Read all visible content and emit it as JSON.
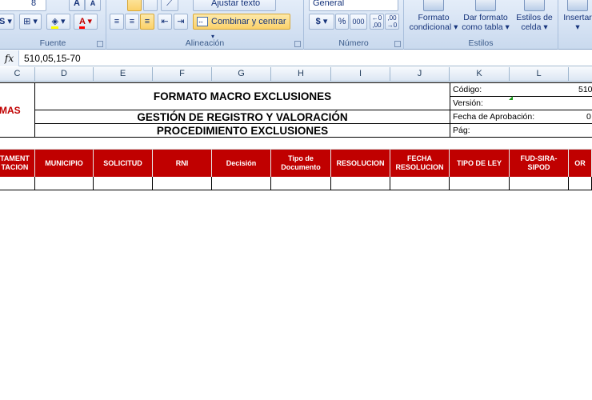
{
  "ribbon": {
    "font_group": {
      "label": "Fuente",
      "font_size": "8",
      "grow_label": "A",
      "shrink_label": "A"
    },
    "alignment_group": {
      "label": "Alineación",
      "wrap_label": "Ajustar texto",
      "merge_label": "Combinar y centrar"
    },
    "number_group": {
      "label": "Número",
      "format_value": "General",
      "currency": "$",
      "percent": "%",
      "thousands": "000",
      "inc_decimals": "+,0\n,00",
      "dec_decimals": ",00\n→,0"
    },
    "styles_group": {
      "label": "Estilos",
      "conditional": "Formato condicional",
      "as_table": "Dar formato como tabla",
      "cell_styles": "Estilos de celda"
    },
    "cells_group": {
      "insert": "Insertar"
    }
  },
  "formula_bar": {
    "fx": "fx",
    "value": "510,05,15-70"
  },
  "columns": [
    "C",
    "D",
    "E",
    "F",
    "G",
    "H",
    "I",
    "J",
    "K",
    "L"
  ],
  "header": {
    "logo_text": "MAS",
    "title1": "FORMATO MACRO EXCLUSIONES",
    "title2": "GESTIÓN DE REGISTRO Y VALORACIÓN",
    "title3": "PROCEDIMIENTO EXCLUSIONES",
    "codigo_label": "Código:",
    "codigo_value": "510",
    "version_label": "Versión:",
    "fecha_label": "Fecha de Aprobación:",
    "fecha_value": "0",
    "pag_label": "Pág:"
  },
  "table_headers": [
    "TAMENT\nTACION",
    "MUNICIPIO",
    "SOLICITUD",
    "RNI",
    "Decisión",
    "Tipo de\nDocumento",
    "RESOLUCION",
    "FECHA\nRESOLUCION",
    "TIPO DE LEY",
    "FUD-SIRA-SIPOD",
    "OR"
  ],
  "colors": {
    "header_red": "#c00000",
    "logo_red": "#c00000"
  }
}
